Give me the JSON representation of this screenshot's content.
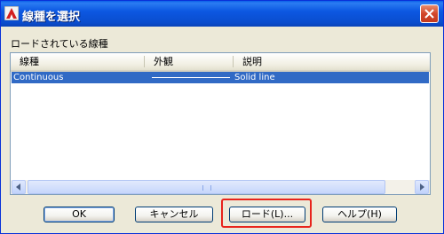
{
  "window": {
    "title": "線種を選択"
  },
  "group": {
    "label": "ロードされている線種"
  },
  "list": {
    "columns": [
      "線種",
      "外観",
      "説明"
    ],
    "rows": [
      {
        "linetype": "Continuous",
        "description": "Solid line",
        "selected": true
      }
    ]
  },
  "buttons": {
    "ok": "OK",
    "cancel": "キャンセル",
    "load": "ロード(L)...",
    "help": "ヘルプ(H)"
  },
  "colors": {
    "titlebar": "#0a55d9",
    "selection": "#316ac5",
    "highlight_box": "#e8241c",
    "dialog_bg": "#ece9d8"
  },
  "icons": {
    "app": "autocad-icon",
    "close": "close-icon",
    "scroll_left": "chevron-left-icon",
    "scroll_right": "chevron-right-icon"
  }
}
